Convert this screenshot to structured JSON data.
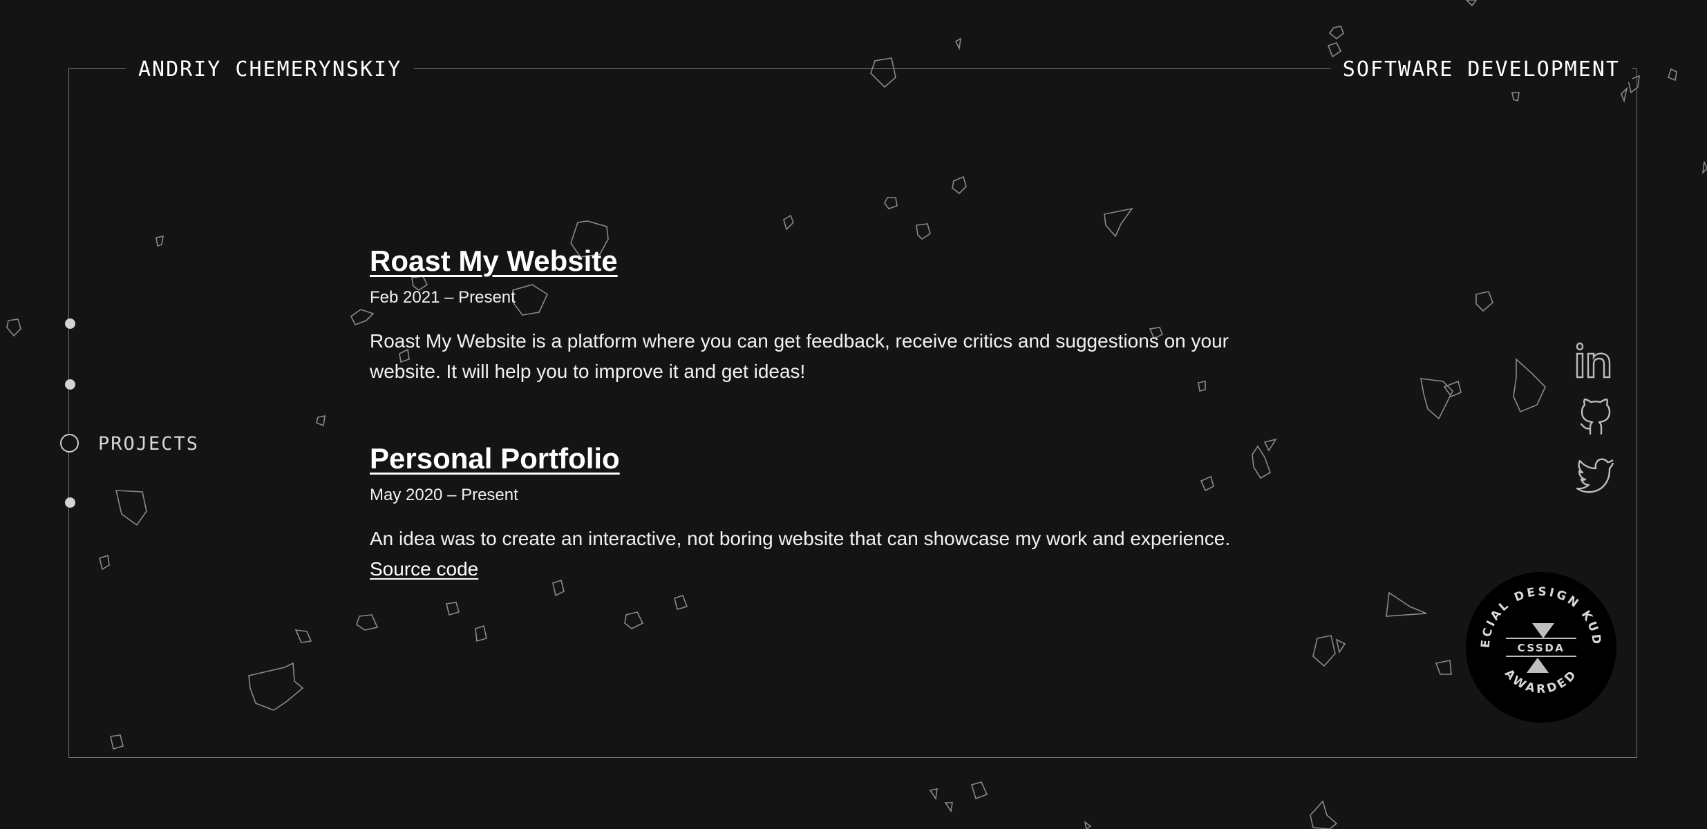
{
  "header": {
    "name": "ANDRIY CHEMERYNSKIY",
    "role": "SOFTWARE DEVELOPMENT"
  },
  "nav": {
    "active_section": "PROJECTS"
  },
  "projects": [
    {
      "title": "Roast My Website",
      "date": "Feb 2021 – Present",
      "description": "Roast My Website is a platform where you can get feedback, receive critics and suggestions on your website. It will help you to improve it and get ideas!"
    },
    {
      "title": "Personal Portfolio",
      "date": "May 2020 – Present",
      "description": "An idea was to create an interactive, not boring website that can showcase my work and experience.",
      "link_label": "Source code"
    }
  ],
  "social": {
    "icons": [
      "linkedin-icon",
      "github-icon",
      "twitter-icon"
    ]
  },
  "badge": {
    "top_text": "SPECIAL DESIGN KUDOS",
    "brand": "CSSDA",
    "bottom_text": "AWARDED"
  },
  "colors": {
    "background": "#141414",
    "text": "#ffffff",
    "frame": "#6f6f6f",
    "shard_stroke": "#8a8a8a"
  }
}
